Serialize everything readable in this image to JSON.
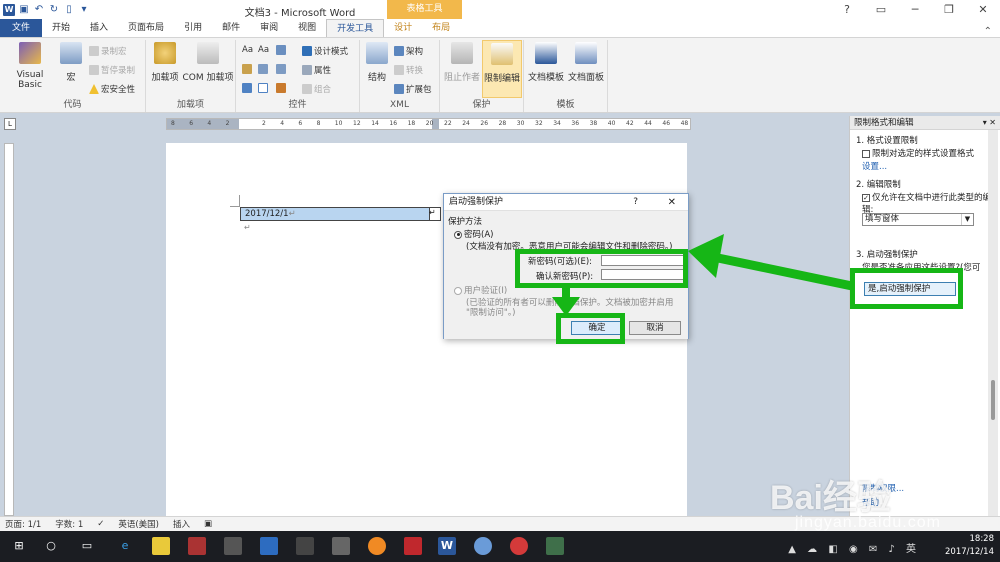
{
  "window": {
    "title": "文档3 - Microsoft Word",
    "context_tab_group": "表格工具"
  },
  "tabs": [
    {
      "label": "文件"
    },
    {
      "label": "开始"
    },
    {
      "label": "插入"
    },
    {
      "label": "页面布局"
    },
    {
      "label": "引用"
    },
    {
      "label": "邮件"
    },
    {
      "label": "审阅"
    },
    {
      "label": "视图"
    },
    {
      "label": "开发工具"
    },
    {
      "label": "设计"
    },
    {
      "label": "布局"
    }
  ],
  "ribbon": {
    "code": {
      "label": "代码",
      "visual_basic": "Visual Basic",
      "macros": "宏",
      "record_macro": "录制宏",
      "pause_recording": "暂停录制",
      "macro_security": "宏安全性"
    },
    "addins": {
      "label": "加载项",
      "addins_btn": "加载项",
      "com_addins": "COM 加载项"
    },
    "controls": {
      "label": "控件",
      "design_mode": "设计模式",
      "properties": "属性",
      "group": "组合",
      "aa1": "Aa",
      "aa2": "Aa"
    },
    "xml": {
      "label": "XML",
      "structure": "结构",
      "schema": "架构",
      "transform": "转换",
      "expansion_packs": "扩展包"
    },
    "protect": {
      "label": "保护",
      "block_authors": "阻止作者",
      "restrict_editing": "限制编辑"
    },
    "templates": {
      "label": "模板",
      "document_template": "文档模板",
      "document_panel": "文档面板"
    }
  },
  "ruler": {
    "labels": [
      "8",
      "6",
      "4",
      "2",
      "",
      "2",
      "4",
      "6",
      "8",
      "10",
      "12",
      "14",
      "16",
      "18",
      "20",
      "22",
      "24",
      "26",
      "28",
      "30",
      "32",
      "34",
      "36",
      "38",
      "40",
      "42",
      "44",
      "46",
      "48"
    ]
  },
  "document": {
    "table_cell_text": "2017/12/1",
    "cell_mark": "↵",
    "para_mark": "↵"
  },
  "dialog": {
    "title": "启动强制保护",
    "help": "?",
    "close": "✕",
    "section_label": "保护方法",
    "password_option": "密码(A)",
    "password_note": "(文档没有加密。恶意用户可能会编辑文件和删除密码。)",
    "new_password_label": "新密码(可选)(E):",
    "confirm_password_label": "确认新密码(P):",
    "user_auth_option": "用户验证(I)",
    "user_auth_note_1": "(已验证的所有者可以删除文档保护。文档被加密并启用",
    "user_auth_note_2": "\"限制访问\"。)",
    "ok_label": "确定",
    "cancel_label": "取消"
  },
  "pane": {
    "title": "限制格式和编辑",
    "section1_title": "1. 格式设置限制",
    "section1_checkbox": "限制对选定的样式设置格式",
    "section1_link": "设置...",
    "section2_title": "2. 编辑限制",
    "section2_checkbox": "仅允许在文档中进行此类型的编辑:",
    "section2_select": "填写窗体",
    "section3_title": "3. 启动强制保护",
    "section3_question": "您是否准备应用这些设置?(您可",
    "section3_button": "是,启动强制保护",
    "bottom_link_1": "限制权限...",
    "bottom_link_2": "帮助"
  },
  "statusbar": {
    "page": "页面: 1/1",
    "words": "字数: 1",
    "language": "英语(美国)",
    "mode": "插入"
  },
  "taskbar": {
    "time": "18:28",
    "date": "2017/12/14",
    "ime": "英"
  },
  "watermark": {
    "brand": "Bai经验",
    "url": "jingyan.baidu.com"
  },
  "colors": {
    "word_blue": "#2b579a",
    "annotation_green": "#16b616",
    "context_tab": "#f2b84b"
  }
}
